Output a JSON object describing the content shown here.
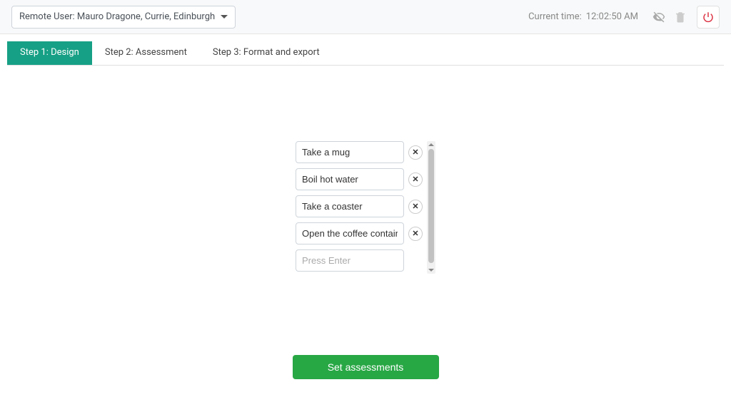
{
  "header": {
    "user_select_label": "Remote User: Mauro Dragone, Currie, Edinburgh",
    "time_label": "Current time:",
    "time_value": "12:02:50 AM"
  },
  "tabs": [
    {
      "label": "Step 1: Design",
      "active": true
    },
    {
      "label": "Step 2: Assessment",
      "active": false
    },
    {
      "label": "Step 3: Format and export",
      "active": false
    }
  ],
  "tasks": [
    {
      "value": "Take a mug"
    },
    {
      "value": "Boil hot water"
    },
    {
      "value": "Take a coaster"
    },
    {
      "value": "Open the coffee container"
    }
  ],
  "new_task_placeholder": "Press Enter",
  "icons": {
    "visibility": "visibility-off-icon",
    "trash": "trash-icon",
    "power": "power-icon"
  },
  "action_button_label": "Set assessments"
}
